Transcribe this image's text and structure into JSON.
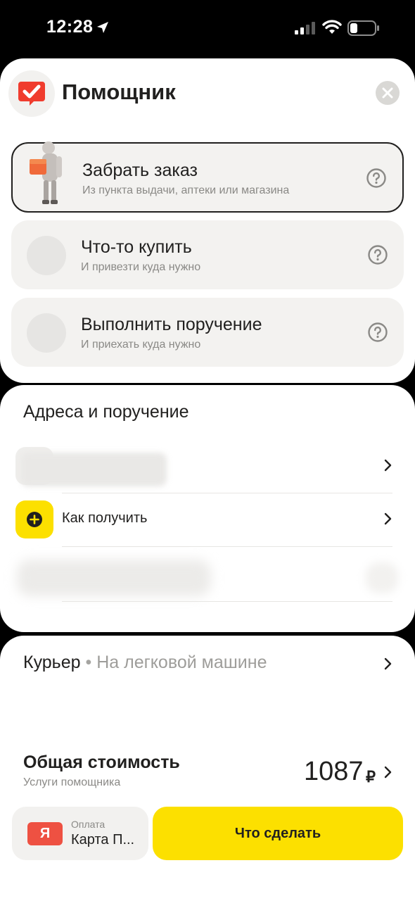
{
  "status_bar": {
    "time": "12:28"
  },
  "helper": {
    "title": "Помощник",
    "options": [
      {
        "title": "Забрать заказ",
        "subtitle": "Из пункта выдачи, аптеки или магазина",
        "selected": true
      },
      {
        "title": "Что-то купить",
        "subtitle": "И привезти куда нужно",
        "selected": false
      },
      {
        "title": "Выполнить поручение",
        "subtitle": "И приехать куда нужно",
        "selected": false
      }
    ]
  },
  "addresses": {
    "title": "Адреса и поручение",
    "how_to_receive_label": "Как получить"
  },
  "courier": {
    "label": "Курьер",
    "separator": "•",
    "type": "На легковой машине"
  },
  "total": {
    "title": "Общая стоимость",
    "subtitle": "Услуги помощника",
    "amount": "1087",
    "currency": "₽"
  },
  "payment": {
    "label": "Оплата",
    "value": "Карта П...",
    "card_icon_text": "Я"
  },
  "action": {
    "label": "Что сделать"
  },
  "colors": {
    "accent_yellow": "#fce000",
    "brand_red": "#ee5142",
    "text_primary": "#21201f",
    "text_secondary": "#8a8986"
  }
}
